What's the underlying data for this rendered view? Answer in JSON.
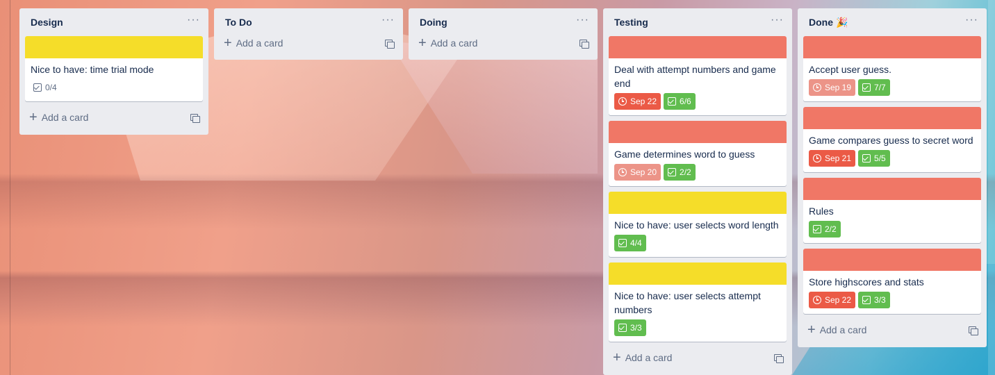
{
  "lists": [
    {
      "title": "Design",
      "menu": "···",
      "cards": [
        {
          "cover": "yellow",
          "title": "Nice to have: time trial mode",
          "checklist": "0/4",
          "checklist_done": false
        }
      ],
      "add_label": "Add a card"
    },
    {
      "title": "To Do",
      "menu": "···",
      "cards": [],
      "add_label": "Add a card"
    },
    {
      "title": "Doing",
      "menu": "···",
      "cards": [],
      "add_label": "Add a card"
    },
    {
      "title": "Testing",
      "menu": "···",
      "cards": [
        {
          "cover": "red",
          "title": "Deal with attempt numbers and game end",
          "due": "Sep 22",
          "due_state": "overdue",
          "checklist": "6/6",
          "checklist_done": true
        },
        {
          "cover": "red",
          "title": "Game determines word to guess",
          "due": "Sep 20",
          "due_state": "past-complete",
          "checklist": "2/2",
          "checklist_done": true
        },
        {
          "cover": "yellow",
          "title": "Nice to have: user selects word length",
          "checklist": "4/4",
          "checklist_done": true
        },
        {
          "cover": "yellow",
          "title": "Nice to have: user selects attempt numbers",
          "checklist": "3/3",
          "checklist_done": true
        }
      ],
      "add_label": "Add a card"
    },
    {
      "title": "Done",
      "title_emoji": "🎉",
      "menu": "···",
      "cards": [
        {
          "cover": "red",
          "title": "Accept user guess.",
          "due": "Sep 19",
          "due_state": "past-complete",
          "checklist": "7/7",
          "checklist_done": true
        },
        {
          "cover": "red",
          "title": "Game compares guess to secret word",
          "due": "Sep 21",
          "due_state": "overdue",
          "checklist": "5/5",
          "checklist_done": true
        },
        {
          "cover": "red",
          "title": "Rules",
          "checklist": "2/2",
          "checklist_done": true
        },
        {
          "cover": "red",
          "title": "Store highscores and stats",
          "due": "Sep 22",
          "due_state": "overdue",
          "checklist": "3/3",
          "checklist_done": true
        }
      ],
      "add_label": "Add a card"
    }
  ],
  "colors": {
    "list_bg": "#ebecf0",
    "cover_yellow": "#f5dd29",
    "cover_red": "#f07766",
    "due_overdue": "#eb5a46",
    "due_past": "#ec9488",
    "checklist_done": "#61bd4f"
  },
  "icons": {
    "menu": "more-horizontal-icon",
    "add": "plus-icon",
    "template": "card-template-icon",
    "due": "clock-icon",
    "checklist": "checkbox-icon"
  }
}
